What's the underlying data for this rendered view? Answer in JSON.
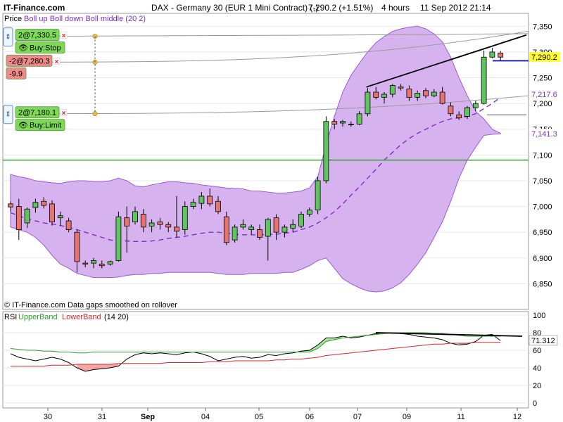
{
  "header": {
    "brand": "IT-Finance.com",
    "title": "DAX - Germany 30 (EUR 1 Mini Contract) (-)",
    "price": "7,290.2 (+1.51%)",
    "interval": "4 hours",
    "datetime": "11 Sep 2012 21:14"
  },
  "price_panel": {
    "legend_price": "Price",
    "legend_boll": "Boll up Boll down Boll middle (20 2)",
    "footer": "© IT-Finance.com  Data gaps smoothed on rollover",
    "colors": {
      "up": "#5fc65f",
      "down": "#e87373",
      "band_fill": "#d6b3ee",
      "band_line": "#9a5bd6",
      "middle": "#7a30c8",
      "grid": "#e8e8e8"
    }
  },
  "orders": [
    {
      "label": "2@7,330.5",
      "action": "Buy:Stop",
      "level": 7330.5,
      "color": "#7ed957"
    },
    {
      "label": "-2@7,280.3",
      "action": "-9.9",
      "level": 7280.3,
      "color": "#f08a8a"
    },
    {
      "label": "2@7,180.1",
      "action": "Buy:Limit",
      "level": 7180.1,
      "color": "#7ed957"
    }
  ],
  "right_labels": {
    "current_price": "7,290.2",
    "boll_upper": "7,217.6",
    "boll_lower": "7,141.3",
    "rsi_value": "71.312"
  },
  "rsi_panel": {
    "legend_rsi": "RSI",
    "legend_upper": "UpperBand",
    "legend_lower": "LowerBand",
    "params": "(14 20)"
  },
  "chart_data": [
    {
      "type": "candlestick",
      "title": "DAX - Germany 30 (EUR 1 Mini Contract) (-)",
      "ylim": [
        6800,
        7375
      ],
      "y_ticks": [
        7350,
        7300,
        7250,
        7200,
        7150,
        7100,
        7050,
        7000,
        6950,
        6900,
        6850
      ],
      "x_tick_labels": [
        "30",
        "31",
        "Sep",
        "04",
        "05",
        "06",
        "07",
        "09",
        "11",
        "12"
      ],
      "horizontal_lines": [
        {
          "name": "support",
          "value": 7090,
          "color": "#2ca02c"
        },
        {
          "name": "current",
          "value": 7283,
          "color": "#2020c0"
        }
      ],
      "candles": [
        {
          "o": 7005,
          "h": 7010,
          "l": 6990,
          "c": 6999
        },
        {
          "o": 7000,
          "h": 7015,
          "l": 6935,
          "c": 6955
        },
        {
          "o": 6968,
          "h": 6998,
          "l": 6958,
          "c": 6995
        },
        {
          "o": 6998,
          "h": 7015,
          "l": 6988,
          "c": 7008
        },
        {
          "o": 7010,
          "h": 7018,
          "l": 6996,
          "c": 7002
        },
        {
          "o": 7005,
          "h": 7012,
          "l": 6963,
          "c": 6970
        },
        {
          "o": 6978,
          "h": 6990,
          "l": 6962,
          "c": 6982
        },
        {
          "o": 6972,
          "h": 6978,
          "l": 6950,
          "c": 6955
        },
        {
          "o": 6950,
          "h": 6955,
          "l": 6872,
          "c": 6893
        },
        {
          "o": 6890,
          "h": 6895,
          "l": 6882,
          "c": 6888
        },
        {
          "o": 6890,
          "h": 6900,
          "l": 6880,
          "c": 6895
        },
        {
          "o": 6888,
          "h": 6895,
          "l": 6880,
          "c": 6885
        },
        {
          "o": 6888,
          "h": 6895,
          "l": 6885,
          "c": 6893
        },
        {
          "o": 6895,
          "h": 6990,
          "l": 6893,
          "c": 6980
        },
        {
          "o": 6978,
          "h": 7000,
          "l": 6910,
          "c": 6962
        },
        {
          "o": 6970,
          "h": 7000,
          "l": 6965,
          "c": 6990
        },
        {
          "o": 6985,
          "h": 6995,
          "l": 6950,
          "c": 6960
        },
        {
          "o": 6962,
          "h": 6975,
          "l": 6950,
          "c": 6968
        },
        {
          "o": 6970,
          "h": 6978,
          "l": 6955,
          "c": 6965
        },
        {
          "o": 6965,
          "h": 6970,
          "l": 6950,
          "c": 6960
        },
        {
          "o": 6960,
          "h": 7020,
          "l": 6940,
          "c": 6952
        },
        {
          "o": 6955,
          "h": 7010,
          "l": 6945,
          "c": 7000
        },
        {
          "o": 7000,
          "h": 7015,
          "l": 6995,
          "c": 7008
        },
        {
          "o": 7006,
          "h": 7028,
          "l": 6995,
          "c": 7020
        },
        {
          "o": 7020,
          "h": 7035,
          "l": 7000,
          "c": 7005
        },
        {
          "o": 7010,
          "h": 7020,
          "l": 6985,
          "c": 6990
        },
        {
          "o": 6980,
          "h": 6990,
          "l": 6925,
          "c": 6930
        },
        {
          "o": 6935,
          "h": 6965,
          "l": 6930,
          "c": 6960
        },
        {
          "o": 6960,
          "h": 6975,
          "l": 6955,
          "c": 6965
        },
        {
          "o": 6955,
          "h": 6965,
          "l": 6945,
          "c": 6960
        },
        {
          "o": 6955,
          "h": 6965,
          "l": 6935,
          "c": 6940
        },
        {
          "o": 6942,
          "h": 6978,
          "l": 6895,
          "c": 6975
        },
        {
          "o": 6978,
          "h": 6985,
          "l": 6935,
          "c": 6950
        },
        {
          "o": 6950,
          "h": 6965,
          "l": 6940,
          "c": 6960
        },
        {
          "o": 6958,
          "h": 6975,
          "l": 6950,
          "c": 6965
        },
        {
          "o": 6962,
          "h": 6990,
          "l": 6958,
          "c": 6985
        },
        {
          "o": 6985,
          "h": 6998,
          "l": 6980,
          "c": 6993
        },
        {
          "o": 6993,
          "h": 7058,
          "l": 6985,
          "c": 7050
        },
        {
          "o": 7050,
          "h": 7175,
          "l": 7045,
          "c": 7165
        },
        {
          "o": 7165,
          "h": 7170,
          "l": 7150,
          "c": 7160
        },
        {
          "o": 7162,
          "h": 7168,
          "l": 7155,
          "c": 7165
        },
        {
          "o": 7160,
          "h": 7165,
          "l": 7155,
          "c": 7160
        },
        {
          "o": 7160,
          "h": 7185,
          "l": 7158,
          "c": 7180
        },
        {
          "o": 7180,
          "h": 7230,
          "l": 7175,
          "c": 7222
        },
        {
          "o": 7222,
          "h": 7232,
          "l": 7208,
          "c": 7212
        },
        {
          "o": 7212,
          "h": 7222,
          "l": 7200,
          "c": 7218
        },
        {
          "o": 7218,
          "h": 7238,
          "l": 7212,
          "c": 7235
        },
        {
          "o": 7232,
          "h": 7238,
          "l": 7225,
          "c": 7230
        },
        {
          "o": 7228,
          "h": 7235,
          "l": 7205,
          "c": 7212
        },
        {
          "o": 7212,
          "h": 7225,
          "l": 7205,
          "c": 7220
        },
        {
          "o": 7225,
          "h": 7230,
          "l": 7210,
          "c": 7215
        },
        {
          "o": 7215,
          "h": 7228,
          "l": 7212,
          "c": 7222
        },
        {
          "o": 7222,
          "h": 7232,
          "l": 7198,
          "c": 7200
        },
        {
          "o": 7195,
          "h": 7202,
          "l": 7175,
          "c": 7180
        },
        {
          "o": 7178,
          "h": 7185,
          "l": 7168,
          "c": 7172
        },
        {
          "o": 7175,
          "h": 7195,
          "l": 7170,
          "c": 7192
        },
        {
          "o": 7192,
          "h": 7205,
          "l": 7185,
          "c": 7200
        },
        {
          "o": 7200,
          "h": 7303,
          "l": 7198,
          "c": 7290
        },
        {
          "o": 7290,
          "h": 7308,
          "l": 7288,
          "c": 7300
        },
        {
          "o": 7298,
          "h": 7302,
          "l": 7283,
          "c": 7290
        }
      ],
      "bollinger": {
        "upper": [
          7062,
          7058,
          7055,
          7050,
          7048,
          7046,
          7045,
          7048,
          7050,
          7050,
          7048,
          7048,
          7050,
          7055,
          7050,
          7040,
          7038,
          7042,
          7045,
          7048,
          7048,
          7046,
          7045,
          7042,
          7040,
          7038,
          7036,
          7035,
          7034,
          7030,
          7030,
          7028,
          7026,
          7026,
          7028,
          7030,
          7036,
          7058,
          7120,
          7175,
          7222,
          7255,
          7278,
          7300,
          7318,
          7330,
          7340,
          7345,
          7348,
          7350,
          7345,
          7335,
          7320,
          7290,
          7250,
          7215,
          7185,
          7170,
          7150,
          7142
        ],
        "middle": [
          6988,
          6982,
          6976,
          6972,
          6968,
          6966,
          6963,
          6960,
          6955,
          6950,
          6945,
          6940,
          6935,
          6933,
          6933,
          6932,
          6932,
          6933,
          6935,
          6938,
          6940,
          6942,
          6945,
          6948,
          6950,
          6950,
          6948,
          6946,
          6945,
          6945,
          6945,
          6946,
          6946,
          6948,
          6950,
          6955,
          6960,
          6968,
          6978,
          6990,
          7005,
          7022,
          7038,
          7055,
          7072,
          7090,
          7105,
          7120,
          7132,
          7142,
          7150,
          7158,
          7165,
          7170,
          7172,
          7175,
          7180,
          7190,
          7200,
          7212
        ],
        "lower": [
          6960,
          6955,
          6950,
          6940,
          6925,
          6905,
          6888,
          6880,
          6870,
          6866,
          6862,
          6862,
          6862,
          6863,
          6866,
          6868,
          6868,
          6870,
          6870,
          6872,
          6872,
          6872,
          6872,
          6872,
          6872,
          6870,
          6868,
          6868,
          6868,
          6870,
          6870,
          6870,
          6870,
          6872,
          6872,
          6878,
          6885,
          6895,
          6900,
          6880,
          6860,
          6850,
          6842,
          6836,
          6834,
          6836,
          6842,
          6852,
          6868,
          6888,
          6910,
          6940,
          6970,
          7010,
          7055,
          7090,
          7115,
          7138,
          7140,
          7141
        ]
      },
      "trendlines": [
        {
          "name": "resistance",
          "x0": 42,
          "y0": 7232,
          "x1": 59,
          "y1": 7333
        },
        {
          "name": "upper-channel",
          "x0": 0,
          "y0": 7320,
          "x1": 59,
          "y1": 7330
        }
      ]
    },
    {
      "type": "line",
      "title": "RSI",
      "ylim": [
        0,
        100
      ],
      "y_ticks": [
        100,
        80,
        60,
        40,
        20,
        0
      ],
      "series": [
        {
          "name": "RSI",
          "color": "#000000",
          "values": [
            56,
            52,
            50,
            48,
            50,
            52,
            50,
            46,
            40,
            36,
            38,
            39,
            40,
            42,
            50,
            55,
            57,
            56,
            57,
            56,
            55,
            57,
            58,
            56,
            53,
            48,
            50,
            52,
            53,
            51,
            52,
            55,
            54,
            56,
            57,
            59,
            60,
            66,
            74,
            74,
            76,
            74,
            75,
            77,
            79,
            80,
            80,
            79,
            78,
            76,
            75,
            74,
            72,
            68,
            66,
            67,
            70,
            77,
            78,
            71
          ]
        },
        {
          "name": "UpperBand",
          "color": "#2ca02c",
          "values": [
            62,
            61,
            60,
            60,
            59,
            59,
            58,
            58,
            57,
            57,
            58,
            58,
            58,
            58,
            58,
            58,
            58,
            58,
            58,
            58,
            58,
            58,
            58,
            58,
            58,
            58,
            58,
            58,
            58,
            58,
            58,
            58,
            58,
            58,
            58,
            58,
            58,
            62,
            70,
            72,
            74,
            75,
            76,
            77,
            78,
            79,
            80,
            80,
            80,
            80,
            80,
            79,
            79,
            78,
            77,
            76,
            76,
            76,
            76,
            76
          ]
        },
        {
          "name": "LowerBand",
          "color": "#d62728",
          "values": [
            42,
            42,
            42,
            42,
            42,
            43,
            43,
            43,
            44,
            44,
            44,
            44,
            44,
            45,
            45,
            45,
            45,
            45,
            45,
            46,
            46,
            46,
            46,
            46,
            47,
            47,
            47,
            48,
            48,
            48,
            48,
            48,
            49,
            49,
            50,
            50,
            51,
            52,
            54,
            55,
            56,
            57,
            58,
            59,
            60,
            61,
            62,
            63,
            64,
            65,
            66,
            67,
            67,
            68,
            68,
            68,
            69,
            69,
            69,
            69
          ]
        }
      ],
      "trendlines": [
        {
          "name": "rsi-resistance",
          "x0": 45,
          "y0": 80,
          "x1": 59,
          "y1": 76
        }
      ]
    }
  ]
}
